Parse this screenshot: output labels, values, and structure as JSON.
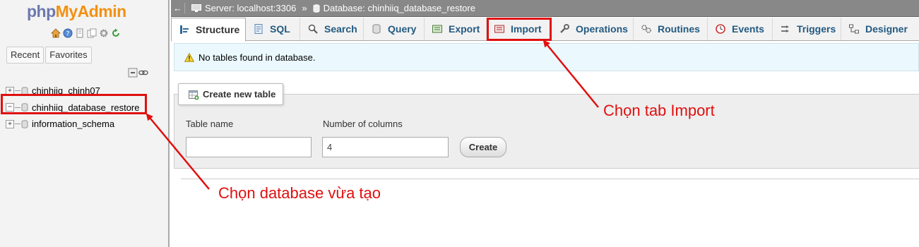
{
  "nav": {
    "logo_php": "php",
    "logo_myadmin": "MyAdmin",
    "tabs": [
      "Recent",
      "Favorites"
    ],
    "databases": [
      {
        "name": "chinhiiq_chinh07",
        "expander": "+"
      },
      {
        "name": "chinhiiq_database_restore",
        "expander": "−"
      },
      {
        "name": "information_schema",
        "expander": "+"
      }
    ]
  },
  "topbar": {
    "back": "←",
    "server": "Server: localhost:3306",
    "separator": "»",
    "database": "Database: chinhiiq_database_restore"
  },
  "tabs": [
    {
      "label": "Structure",
      "icon": "structure-icon"
    },
    {
      "label": "SQL",
      "icon": "sql-icon"
    },
    {
      "label": "Search",
      "icon": "search-icon"
    },
    {
      "label": "Query",
      "icon": "query-icon"
    },
    {
      "label": "Export",
      "icon": "export-icon"
    },
    {
      "label": "Import",
      "icon": "import-icon"
    },
    {
      "label": "Operations",
      "icon": "wrench-icon"
    },
    {
      "label": "Routines",
      "icon": "routines-icon"
    },
    {
      "label": "Events",
      "icon": "clock-icon"
    },
    {
      "label": "Triggers",
      "icon": "triggers-icon"
    },
    {
      "label": "Designer",
      "icon": "designer-icon"
    }
  ],
  "notice": {
    "text": "No tables found in database."
  },
  "create_table": {
    "legend": "Create new table",
    "table_name_label": "Table name",
    "table_name_value": "",
    "columns_label": "Number of columns",
    "columns_value": "4",
    "button": "Create"
  },
  "annotations": {
    "import": "Chọn tab Import",
    "database": "Chọn database vừa tạo"
  },
  "colors": {
    "highlight": "#e01010",
    "link": "#235a81"
  }
}
